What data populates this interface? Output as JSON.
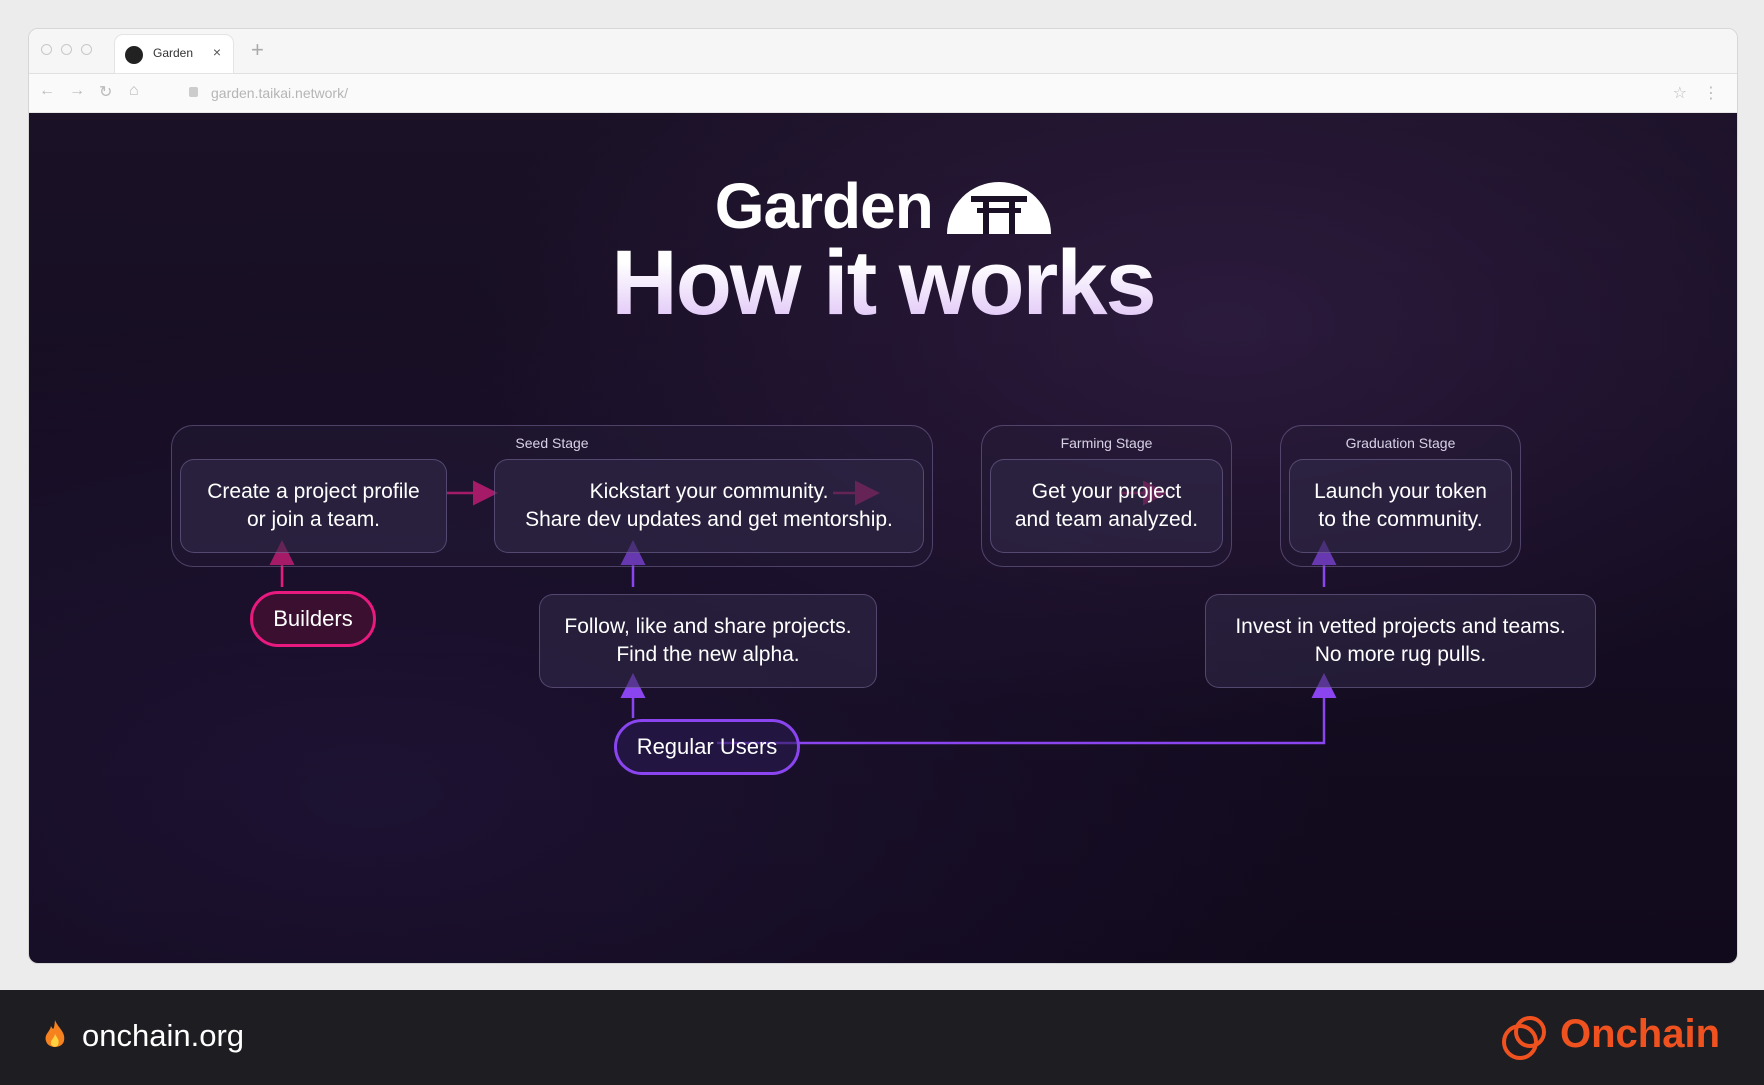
{
  "browser": {
    "tab_title": "Garden",
    "tab_close": "×",
    "new_tab": "+",
    "url": "garden.taikai.network/",
    "nav": {
      "back": "←",
      "forward": "→",
      "reload": "↻",
      "home": "⌂"
    },
    "star": "☆",
    "menu": "⋮"
  },
  "hero": {
    "brand": "Garden",
    "headline": "How it works"
  },
  "stages": {
    "seed": "Seed Stage",
    "farming": "Farming Stage",
    "graduation": "Graduation Stage"
  },
  "boxes": {
    "create_line1": "Create a project profile",
    "create_line2": "or join a team.",
    "kickstart_line1": "Kickstart your community.",
    "kickstart_line2": "Share dev updates and get mentorship.",
    "analyzed_line1": "Get your project",
    "analyzed_line2": "and team analyzed.",
    "launch_line1": "Launch your token",
    "launch_line2": "to the community.",
    "follow_line1": "Follow, like and share projects.",
    "follow_line2": "Find the new alpha.",
    "invest_line1": "Invest in vetted projects and teams.",
    "invest_line2": "No more rug pulls."
  },
  "actors": {
    "builders": "Builders",
    "users": "Regular Users"
  },
  "footer": {
    "site": "onchain.org",
    "brand": "Onchain"
  },
  "colors": {
    "builders_accent": "#e8197f",
    "users_accent": "#8a45f0",
    "onchain_orange": "#f0521f"
  },
  "icons": [
    "garden-tab-icon",
    "torii-gate-logo",
    "fire-icon",
    "onchain-logo-icon"
  ]
}
